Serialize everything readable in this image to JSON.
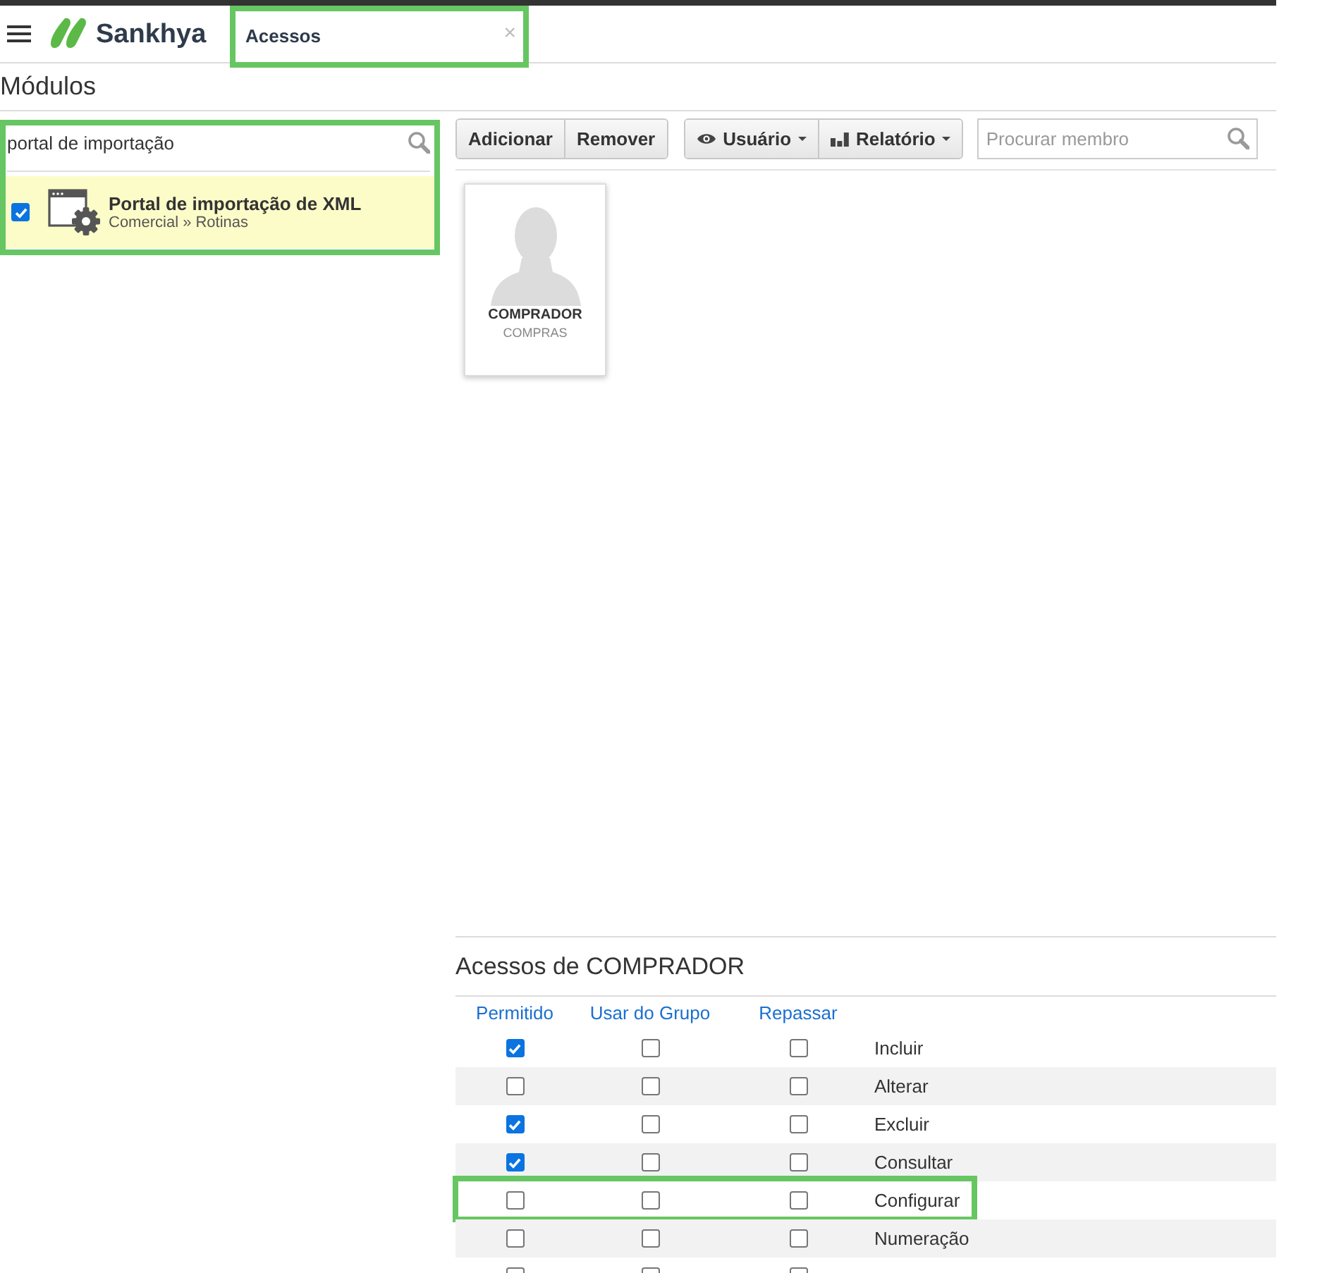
{
  "header": {
    "brand": "Sankhya",
    "tabs": [
      {
        "label": "Acessos",
        "close": "×",
        "selected": true,
        "highlighted": true
      }
    ]
  },
  "page_title": "Módulos",
  "module_search": {
    "value": "portal de importação",
    "highlighted": true
  },
  "modules": [
    {
      "title": "Portal de importação de XML",
      "path": "Comercial » Rotinas",
      "checked": true,
      "selected": true
    }
  ],
  "toolbar": {
    "button_groups": [
      [
        {
          "label": "Adicionar",
          "kind": "action"
        },
        {
          "label": "Remover",
          "kind": "action"
        }
      ],
      [
        {
          "label": "Usuário",
          "kind": "view"
        },
        {
          "label": "Relatório",
          "kind": "report"
        }
      ]
    ],
    "search": {
      "placeholder": "Procurar membro"
    }
  },
  "members": [
    {
      "name": "COMPRADOR",
      "group": "COMPRAS"
    }
  ],
  "access_panel": {
    "title": "Acessos de COMPRADOR",
    "columns": [
      "Permitido",
      "Usar do Grupo",
      "Repassar"
    ],
    "rows": [
      {
        "label": "Incluir",
        "allowed": true,
        "use_group": false,
        "pass_on": false,
        "highlighted": false
      },
      {
        "label": "Alterar",
        "allowed": false,
        "use_group": false,
        "pass_on": false,
        "highlighted": false
      },
      {
        "label": "Excluir",
        "allowed": true,
        "use_group": false,
        "pass_on": false,
        "highlighted": false
      },
      {
        "label": "Consultar",
        "allowed": true,
        "use_group": false,
        "pass_on": false,
        "highlighted": false
      },
      {
        "label": "Configurar",
        "allowed": false,
        "use_group": false,
        "pass_on": false,
        "highlighted": true
      },
      {
        "label": "Numeração",
        "allowed": false,
        "use_group": false,
        "pass_on": false,
        "highlighted": false
      },
      {
        "allowed": false,
        "use_group": false,
        "pass_on": false,
        "highlighted": false
      }
    ]
  }
}
